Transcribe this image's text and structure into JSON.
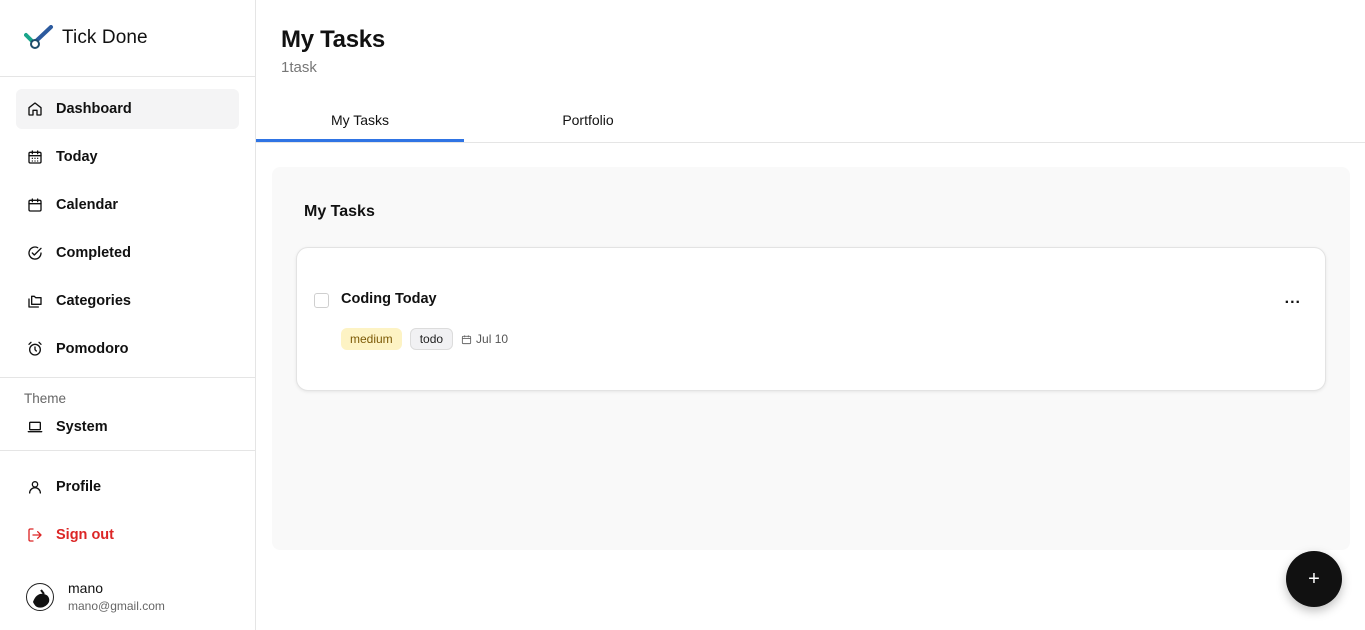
{
  "brand": {
    "name": "Tick Done",
    "logo_icon": "check-logo-icon"
  },
  "sidebar": {
    "items": [
      {
        "label": "Dashboard",
        "icon": "home-icon",
        "active": true
      },
      {
        "label": "Today",
        "icon": "calendar-grid-icon"
      },
      {
        "label": "Calendar",
        "icon": "calendar-icon"
      },
      {
        "label": "Completed",
        "icon": "check-circle-icon"
      },
      {
        "label": "Categories",
        "icon": "folders-icon"
      },
      {
        "label": "Pomodoro",
        "icon": "alarm-clock-icon"
      }
    ],
    "theme": {
      "heading": "Theme",
      "value": "System",
      "icon": "laptop-icon"
    },
    "bottom": [
      {
        "label": "Profile",
        "icon": "user-icon"
      },
      {
        "label": "Sign out",
        "icon": "sign-out-icon",
        "color": "#dc2626"
      }
    ],
    "user": {
      "name": "mano",
      "email": "mano@gmail.com"
    }
  },
  "header": {
    "title": "My Tasks",
    "subtitle": "1task"
  },
  "tabs": [
    {
      "label": "My Tasks",
      "active": true
    },
    {
      "label": "Portfolio",
      "active": false
    }
  ],
  "tab_accent": "#2f74e4",
  "panel": {
    "title": "My Tasks",
    "tasks": [
      {
        "title": "Coding Today",
        "priority": "medium",
        "status": "todo",
        "due": "Jul 10",
        "completed": false,
        "more": "..."
      }
    ]
  },
  "fab": {
    "label": "+"
  }
}
